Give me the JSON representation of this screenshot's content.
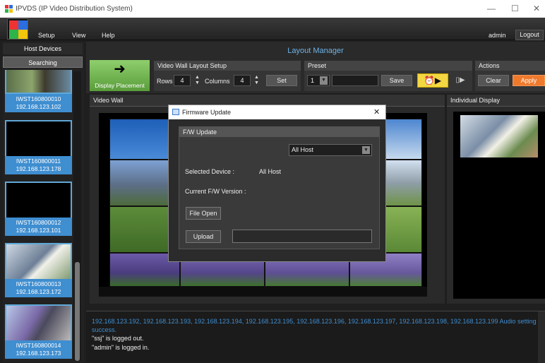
{
  "window": {
    "title": "IPVDS (IP Video Distribution System)",
    "minimize": "—",
    "maximize": "☐",
    "close": "✕"
  },
  "menu": {
    "setup": "Setup",
    "view": "View",
    "help": "Help",
    "user": "admin",
    "logout": "Logout"
  },
  "left": {
    "header": "Host Devices",
    "searching": "Searching",
    "devices": [
      {
        "name": "IWST160800010",
        "ip": "192.168.123.102"
      },
      {
        "name": "IWST160800011",
        "ip": "192.168.123.178"
      },
      {
        "name": "IWST160800012",
        "ip": "192.168.123.101"
      },
      {
        "name": "IWST160800013",
        "ip": "192.168.123.172"
      },
      {
        "name": "IWST160800014",
        "ip": "192.168.123.173"
      }
    ]
  },
  "layout": {
    "title": "Layout Manager",
    "display_placement": "Display Placement",
    "wall_setup": "Video Wall Layout Setup",
    "rows_label": "Rows",
    "rows_value": "4",
    "columns_label": "Columns",
    "columns_value": "4",
    "set": "Set",
    "preset": "Preset",
    "preset_value": "1",
    "save": "Save",
    "actions": "Actions",
    "clear": "Clear",
    "apply": "Apply"
  },
  "panels": {
    "video_wall": "Video Wall",
    "individual": "Individual Display"
  },
  "log": {
    "line1": "192.168.123.192, 192.168.123.193, 192.168.123.194, 192.168.123.195, 192.168.123.196, 192.168.123.197, 192.168.123.198, 192.168.123.199 Audio setting",
    "line2": "success.",
    "line3": "\"ssj\" is logged out.",
    "line4": "\"admin\" is logged in."
  },
  "dialog": {
    "title": "Firmware Update",
    "close": "✕",
    "group": "F/W Update",
    "host_select": "All Host",
    "selected_device_label": "Selected Device :",
    "selected_device_value": "All Host",
    "current_fw_label": "Current F/W Version :",
    "file_open": "File Open",
    "upload": "Upload"
  },
  "colors": {
    "accent": "#3f8ed0",
    "apply": "#f07a2c",
    "green": "#6db44a",
    "title_blue": "#6fb3e8"
  }
}
